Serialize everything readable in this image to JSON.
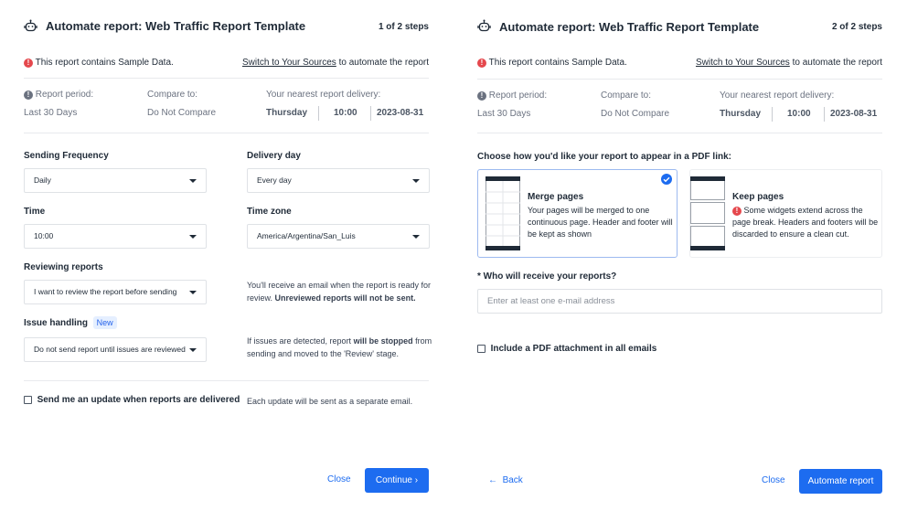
{
  "step1": {
    "title": "Automate report: Web Traffic Report Template",
    "steps": "1 of 2 steps",
    "warning": "This report contains Sample Data.",
    "switch_link": "Switch to Your Sources",
    "switch_suffix": "to automate the report",
    "report_period_label": "Report period:",
    "report_period_value": "Last 30 Days",
    "compare_label": "Compare to:",
    "compare_value": "Do Not Compare",
    "delivery_label": "Your nearest report delivery:",
    "delivery_day": "Thursday",
    "delivery_time": "10:00",
    "delivery_date": "2023-08-31",
    "sending_frequency_label": "Sending Frequency",
    "sending_frequency_value": "Daily",
    "delivery_day_label": "Delivery day",
    "delivery_day_value": "Every day",
    "time_label": "Time",
    "time_value": "10:00",
    "timezone_label": "Time zone",
    "timezone_value": "America/Argentina/San_Luis",
    "reviewing_label": "Reviewing reports",
    "reviewing_value": "I want to review the report before sending",
    "reviewing_help": "You'll receive an email when the report is ready for review.",
    "reviewing_help_bold": "Unreviewed reports will not be sent.",
    "issue_label": "Issue handling",
    "issue_badge": "New",
    "issue_value": "Do not send report until issues are reviewed",
    "issue_help_pre": "If issues are detected, report",
    "issue_help_bold": "will be stopped",
    "issue_help_post": "from sending and moved to the 'Review' stage.",
    "update_checkbox_label": "Send me an update when reports are delivered",
    "update_checked": false,
    "update_help": "Each update will be sent as a separate email.",
    "close": "Close",
    "continue": "Continue"
  },
  "step2": {
    "title": "Automate report: Web Traffic Report Template",
    "steps": "2 of 2 steps",
    "warning": "This report contains Sample Data.",
    "switch_link": "Switch to Your Sources",
    "switch_suffix": "to automate the report",
    "report_period_label": "Report period:",
    "report_period_value": "Last 30 Days",
    "compare_label": "Compare to:",
    "compare_value": "Do Not Compare",
    "delivery_label": "Your nearest report delivery:",
    "delivery_day": "Thursday",
    "delivery_time": "10:00",
    "delivery_date": "2023-08-31",
    "pdf_prompt": "Choose how you'd like your report to appear in a PDF link:",
    "merge_title": "Merge pages",
    "merge_desc": "Your pages will be merged to one continuous page. Header and footer will be kept as shown",
    "keep_title": "Keep pages",
    "keep_desc": "Some widgets extend across the page break. Headers and footers will be discarded to ensure a clean cut.",
    "selected_option": "Merge pages",
    "recipients_label": "* Who will receive your reports?",
    "recipients_placeholder": "Enter at least one e-mail address",
    "attachment_label": "Include a PDF attachment in all emails",
    "attachment_checked": false,
    "back": "Back",
    "close": "Close",
    "automate": "Automate report"
  },
  "colors": {
    "accent": "#1d6cf0",
    "error": "#e5484d"
  }
}
